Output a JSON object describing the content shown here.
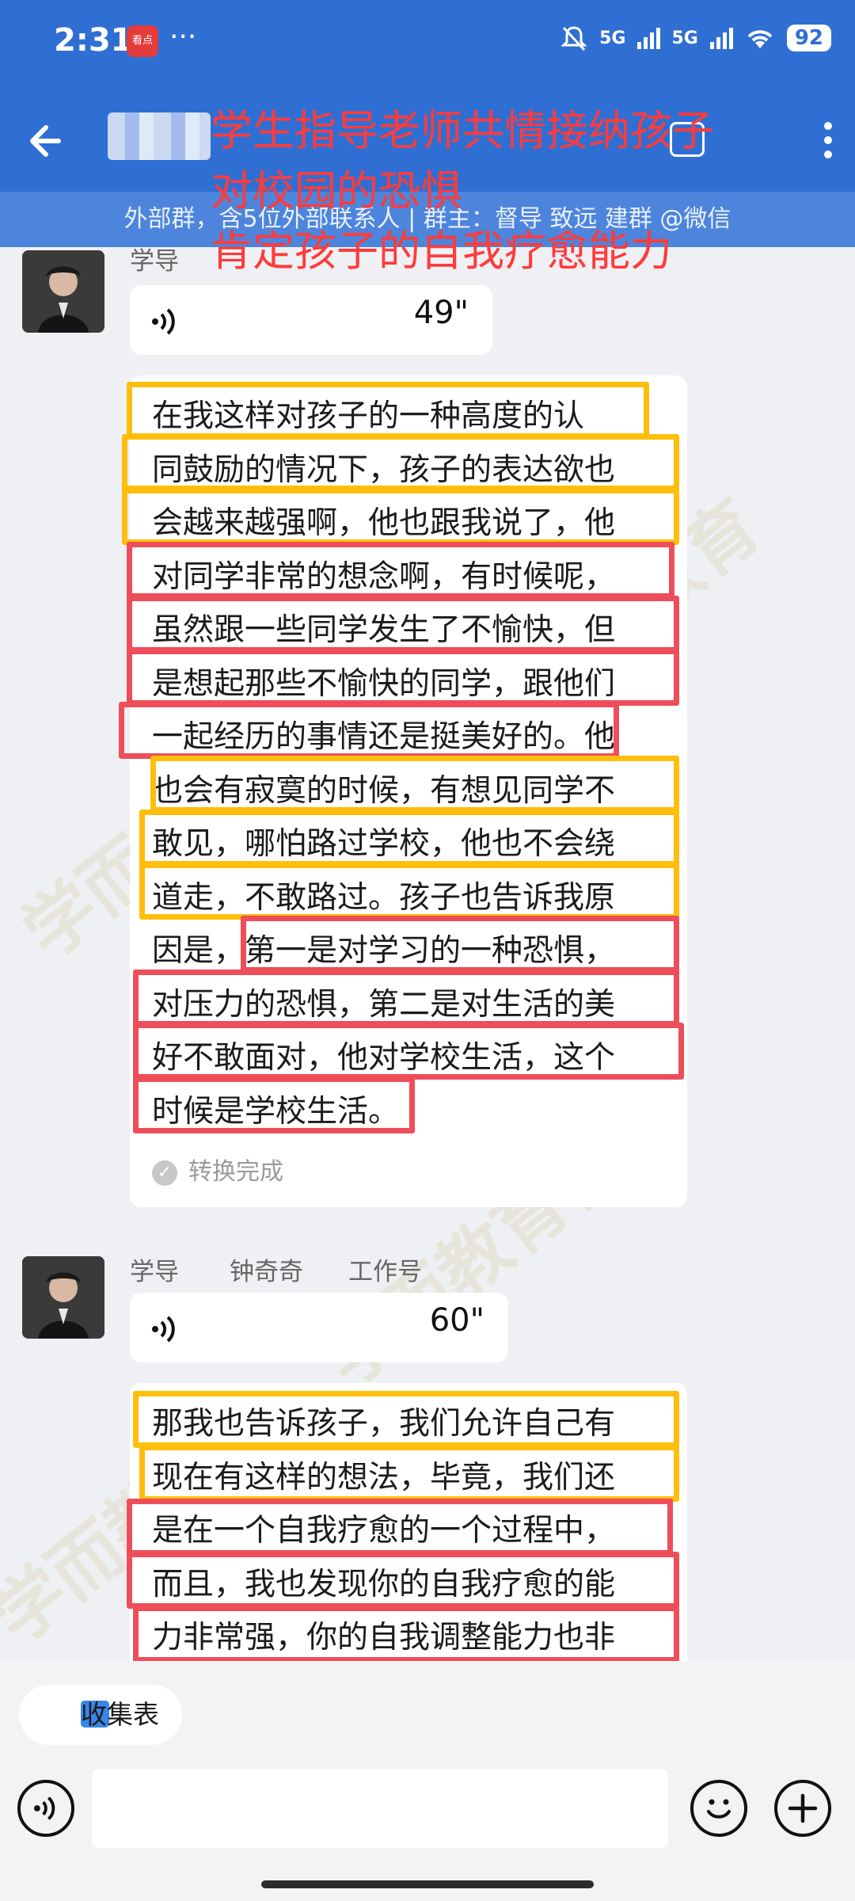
{
  "status_bar": {
    "time": "2:31",
    "app_badge": "看点",
    "network_1": "5G",
    "network_2": "5G",
    "battery": "92"
  },
  "header": {
    "group_info": "外部群，含5位外部联系人 | 群主：督导  致远     建群 @微信"
  },
  "overlay_caption": [
    "学生指导老师共情接纳孩子",
    "对校园的恐惧",
    "肯定孩子的自我疗愈能力"
  ],
  "messages": [
    {
      "sender": "学导",
      "voice_duration": "49\"",
      "transcript_lines": [
        "在我这样对孩子的一种高度的认",
        "同鼓励的情况下，孩子的表达欲也",
        "会越来越强啊，他也跟我说了，他",
        "对同学非常的想念啊，有时候呢，",
        "虽然跟一些同学发生了不愉快，但",
        "是想起那些不愉快的同学，跟他们",
        "一起经历的事情还是挺美好的。他",
        "也会有寂寞的时候，有想见同学不",
        "敢见，哪怕路过学校，他也不会绕",
        "道走，不敢路过。孩子也告诉我原",
        "因是，第一是对学习的一种恐惧，",
        "对压力的恐惧，第二是对生活的美",
        "好不敢面对，他对学校生活，这个",
        "时候是学校生活。"
      ],
      "status": "转换完成"
    },
    {
      "sender": "学导",
      "sender_name": "钟奇奇",
      "sender_tag": "工作号",
      "voice_duration": "60\"",
      "transcript_lines": [
        "那我也告诉孩子，我们允许自己有",
        "现在有这样的想法，毕竟，我们还",
        "是在一个自我疗愈的一个过程中，",
        "而且，我也发现你的自我疗愈的能",
        "力非常强，你的自我调整能力也非"
      ]
    }
  ],
  "bottom": {
    "shortcut_label": "收集表"
  },
  "colors": {
    "header_blue": "#2f6fd3",
    "highlight_yellow": "#ffbe0b",
    "highlight_red": "#ee4e5a",
    "caption_red": "#ff3b3b"
  }
}
